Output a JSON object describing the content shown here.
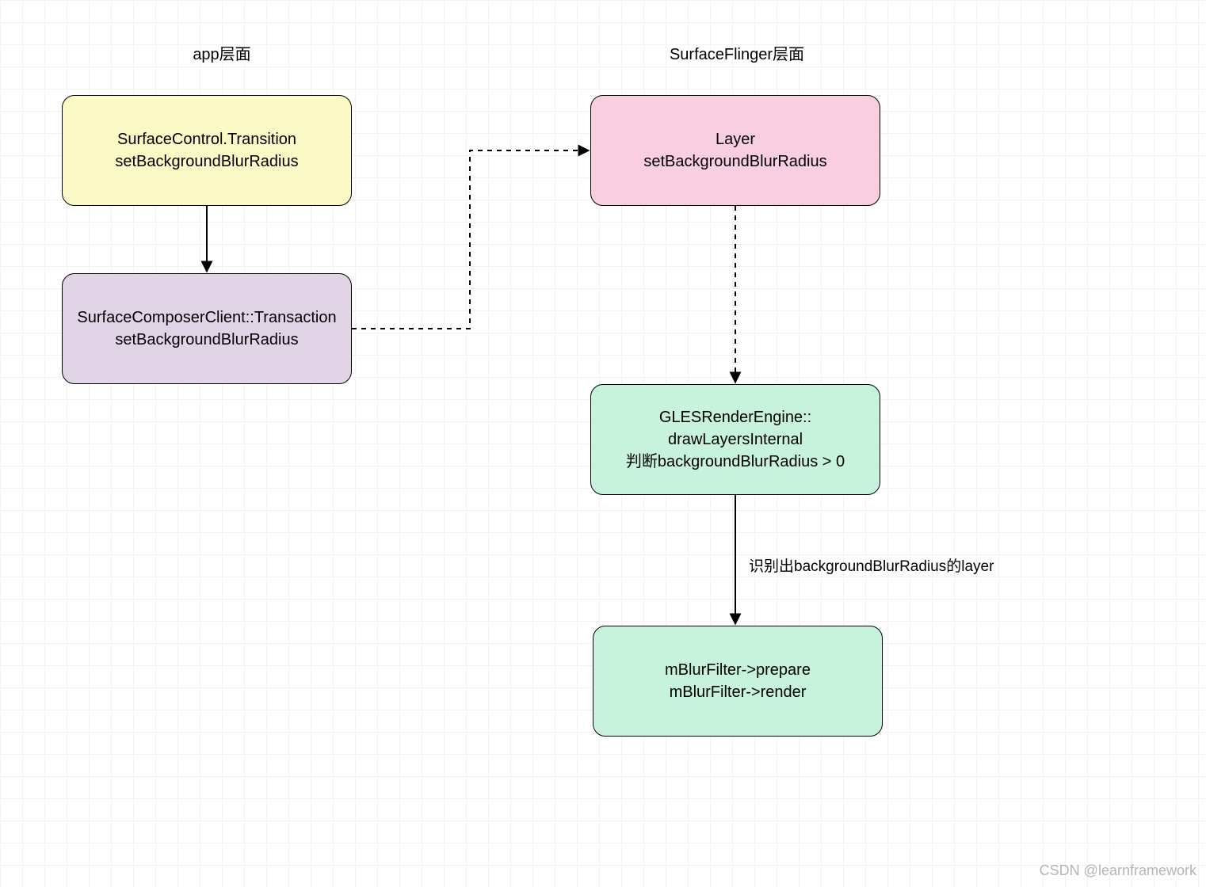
{
  "headers": {
    "left": "app层面",
    "right": "SurfaceFlinger层面"
  },
  "nodes": {
    "n1": {
      "line1": "SurfaceControl.Transition",
      "line2": "setBackgroundBlurRadius"
    },
    "n2": {
      "line1": "SurfaceComposerClient::Transaction",
      "line2": "setBackgroundBlurRadius"
    },
    "n3": {
      "line1": "Layer",
      "line2": "setBackgroundBlurRadius"
    },
    "n4": {
      "line1": "GLESRenderEngine::",
      "line2": "drawLayersInternal",
      "line3": "判断backgroundBlurRadius > 0"
    },
    "n5": {
      "line1": "mBlurFilter->prepare",
      "line2": "mBlurFilter->render"
    }
  },
  "edges": {
    "e4_label": "识别出backgroundBlurRadius的layer"
  },
  "watermark": "CSDN @learnframework",
  "colors": {
    "yellow": "#fbfac6",
    "purple": "#e1d4e7",
    "pink": "#f8cee0",
    "mint": "#c7f3dc"
  }
}
